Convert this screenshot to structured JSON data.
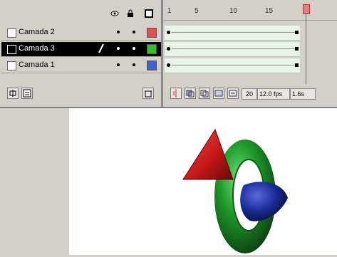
{
  "layers": [
    {
      "name": "Camada 2",
      "color": "#e05050",
      "selected": false
    },
    {
      "name": "Camada 3",
      "color": "#30c030",
      "selected": true
    },
    {
      "name": "Camada 1",
      "color": "#4060d0",
      "selected": false
    }
  ],
  "ruler": {
    "ticks": [
      "1",
      "5",
      "10",
      "15"
    ]
  },
  "status": {
    "frame": "20",
    "fps": "12.0 fps",
    "time": "1.6s"
  },
  "colors": {
    "accent_red": "#cc2222",
    "green": "#1f9a2a",
    "blue": "#1a2d9a"
  }
}
